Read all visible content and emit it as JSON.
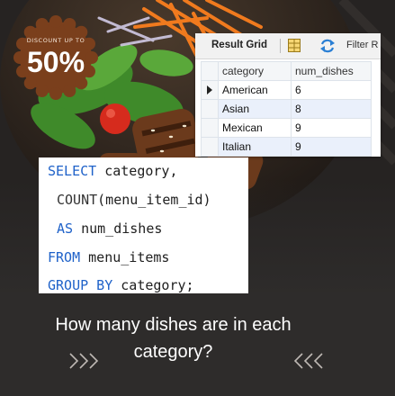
{
  "badge": {
    "label": "DISCOUNT UP TO",
    "value": "50%"
  },
  "result_grid": {
    "toolbar": {
      "title": "Result Grid",
      "filter_label": "Filter R"
    },
    "columns": [
      "category",
      "num_dishes"
    ],
    "rows": [
      {
        "category": "American",
        "num_dishes": "6"
      },
      {
        "category": "Asian",
        "num_dishes": "8"
      },
      {
        "category": "Mexican",
        "num_dishes": "9"
      },
      {
        "category": "Italian",
        "num_dishes": "9"
      }
    ]
  },
  "sql": {
    "line1_kw": "SELECT",
    "line1_rest": " category,",
    "line2_fn": "COUNT",
    "line2_rest": "(menu_item_id)",
    "line3_kw": "AS",
    "line3_rest": " num_dishes",
    "line4_kw": "FROM",
    "line4_rest": " menu_items",
    "line5_kw": "GROUP BY",
    "line5_rest": " category;"
  },
  "headline": {
    "line1": "How many dishes are in each",
    "line2": "category?"
  },
  "colors": {
    "background": "#2e2c2b",
    "badge": "#7a3f1c",
    "keyword_blue": "#1f62c9",
    "row_highlight": "#eaf0fb"
  }
}
